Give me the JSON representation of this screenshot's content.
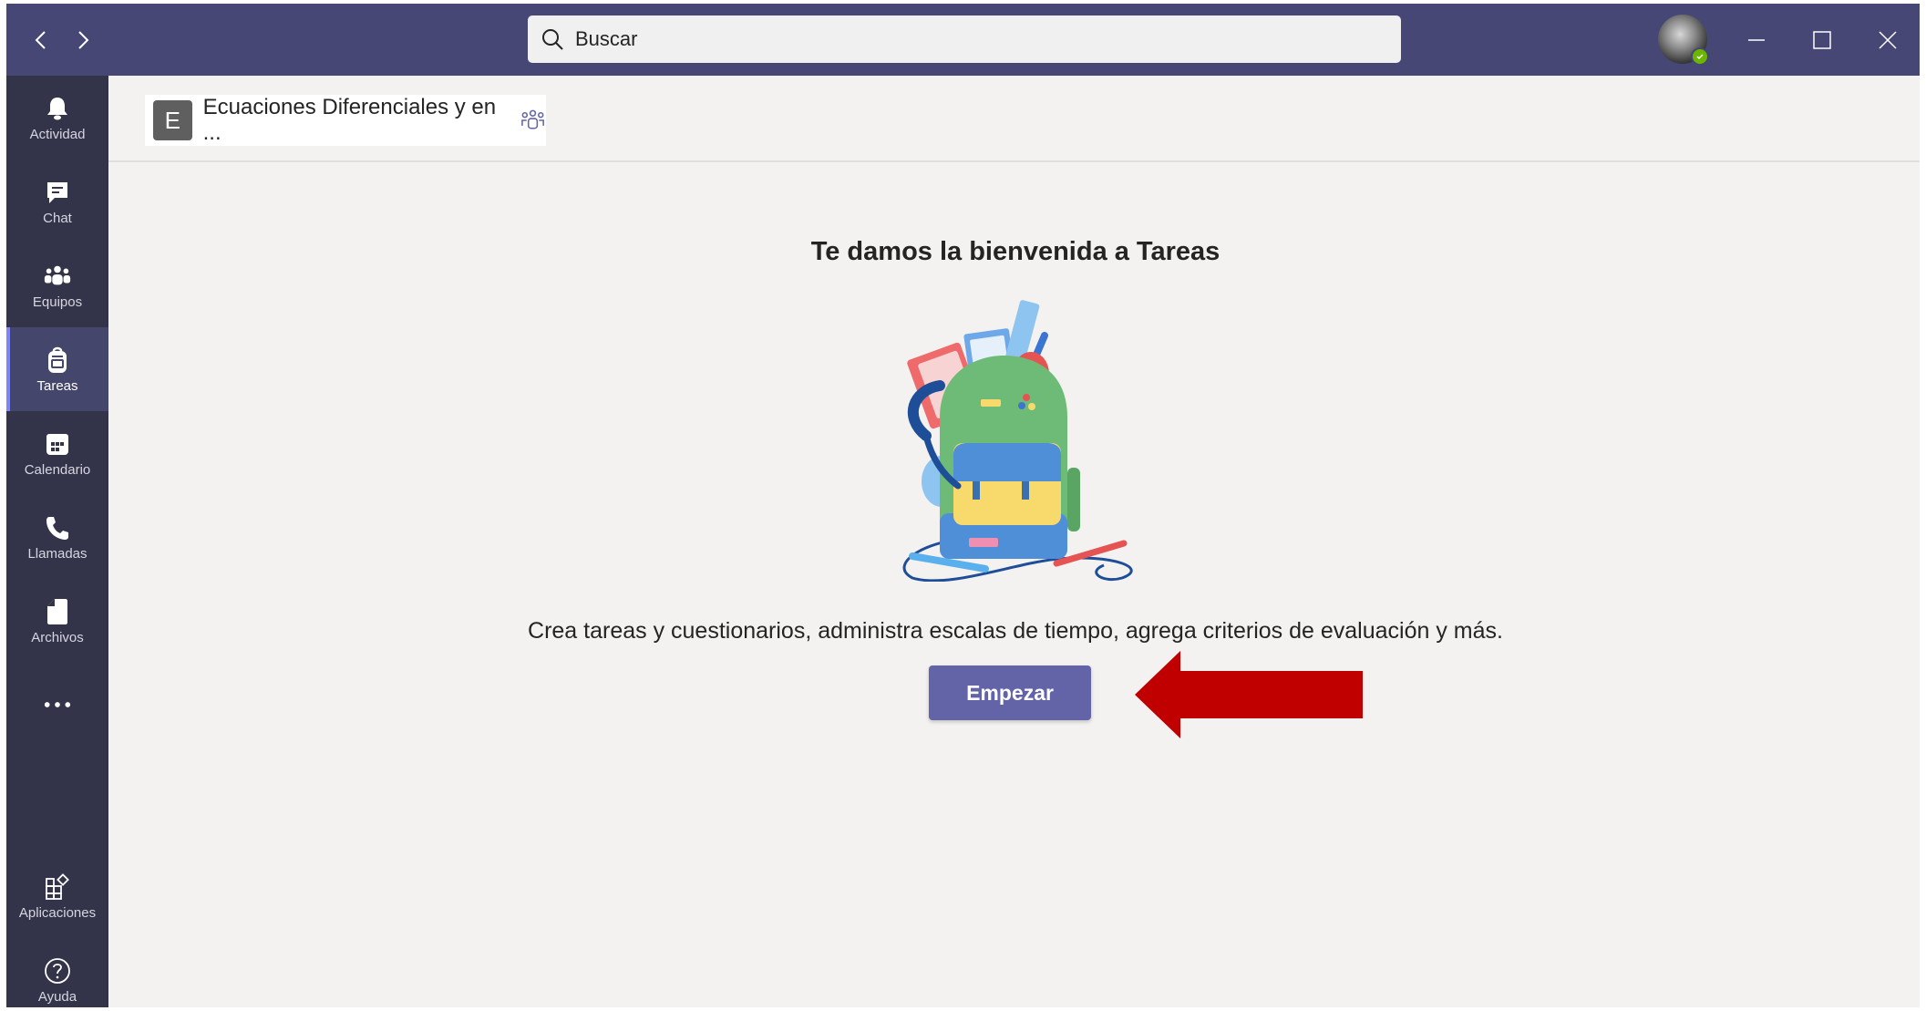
{
  "titlebar": {
    "search_placeholder": "Buscar",
    "back_icon": "chevron-left-icon",
    "forward_icon": "chevron-right-icon"
  },
  "rail": {
    "items": [
      {
        "label": "Actividad",
        "icon": "bell-icon"
      },
      {
        "label": "Chat",
        "icon": "chat-icon"
      },
      {
        "label": "Equipos",
        "icon": "teams-icon"
      },
      {
        "label": "Tareas",
        "icon": "backpack-icon",
        "active": true
      },
      {
        "label": "Calendario",
        "icon": "calendar-icon"
      },
      {
        "label": "Llamadas",
        "icon": "phone-icon"
      },
      {
        "label": "Archivos",
        "icon": "file-icon"
      },
      {
        "label": "",
        "icon": "more-icon"
      }
    ],
    "bottom_items": [
      {
        "label": "Aplicaciones",
        "icon": "apps-icon"
      },
      {
        "label": "Ayuda",
        "icon": "help-icon"
      }
    ]
  },
  "header": {
    "team_initial": "E",
    "team_name": "Ecuaciones Diferenciales y en ..."
  },
  "main": {
    "title": "Te damos la bienvenida a Tareas",
    "description": "Crea tareas y cuestionarios, administra escalas de tiempo, agrega criterios de evaluación y más.",
    "start_button": "Empezar"
  },
  "colors": {
    "titlebar": "#464775",
    "rail": "#33344a",
    "accent": "#6264a7",
    "arrow": "#c00000",
    "presence": "#6bb700"
  }
}
